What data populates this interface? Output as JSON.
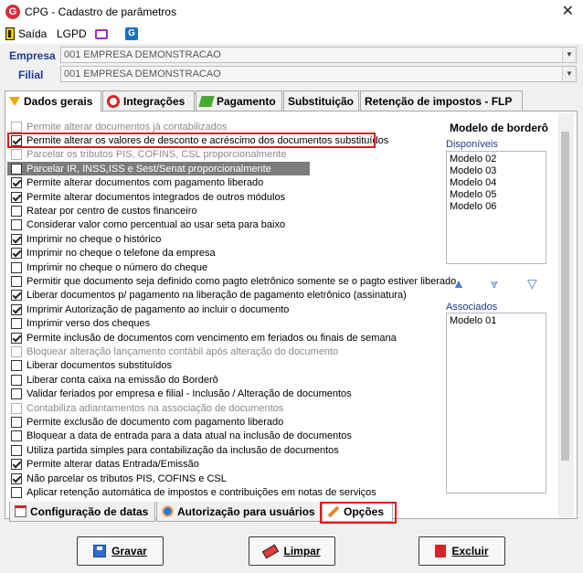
{
  "window": {
    "title": "CPG - Cadastro de parâmetros",
    "icon": "G",
    "close": "✕"
  },
  "toolbar": {
    "exit_label": "Saída",
    "lgpd_label": "LGPD"
  },
  "fields": {
    "empresa_label": "Empresa",
    "empresa_value": "001 EMPRESA DEMONSTRACAO",
    "filial_label": "Filial",
    "filial_value": "001 EMPRESA DEMONSTRACAO"
  },
  "tabs": [
    {
      "label": "Dados gerais",
      "icon": "filter-icon",
      "active": true
    },
    {
      "label": "Integrações",
      "icon": "integration-icon",
      "active": false
    },
    {
      "label": "Pagamento",
      "icon": "payment-icon",
      "active": false
    },
    {
      "label": "Substituição",
      "active": false
    },
    {
      "label": "Retenção de impostos - FLP",
      "active": false
    }
  ],
  "options": [
    {
      "label": "Permite alterar documentos já contabilizados",
      "checked": false,
      "disabled": true
    },
    {
      "label": "Permite alterar os valores de desconto e acréscimo dos documentos substituídos",
      "checked": true,
      "disabled": false
    },
    {
      "label": "Parcelar os tributos PIS, COFINS, CSL proporcionalmente",
      "checked": false,
      "disabled": true
    },
    {
      "label": "Parcelar IR, INSS,ISS e Sest/Senat proporcionalmente",
      "checked": false,
      "disabled": false,
      "selected": true
    },
    {
      "label": "Permite alterar documentos com pagamento liberado",
      "checked": true,
      "disabled": false
    },
    {
      "label": "Permite alterar documentos integrados de outros módulos",
      "checked": true,
      "disabled": false
    },
    {
      "label": "Ratear por centro de custos financeiro",
      "checked": false,
      "disabled": false
    },
    {
      "label": "Considerar valor como percentual ao usar seta para baixo",
      "checked": false,
      "disabled": false
    },
    {
      "label": "Imprimir no cheque o histórico",
      "checked": true,
      "disabled": false
    },
    {
      "label": "Imprimir no cheque o telefone da empresa",
      "checked": true,
      "disabled": false
    },
    {
      "label": "Imprimir no cheque o número do cheque",
      "checked": false,
      "disabled": false
    },
    {
      "label": "Permitir que documento seja definido como pagto eletrônico somente se o pagto estiver liberado",
      "checked": false,
      "disabled": false
    },
    {
      "label": "Liberar documentos p/ pagamento na liberação de pagamento eletrônico (assinatura)",
      "checked": true,
      "disabled": false
    },
    {
      "label": "Imprimir Autorização de pagamento ao incluir o documento",
      "checked": true,
      "disabled": false
    },
    {
      "label": "Imprimir verso dos cheques",
      "checked": false,
      "disabled": false
    },
    {
      "label": "Permite inclusão de documentos com vencimento em feriados ou finais de semana",
      "checked": true,
      "disabled": false
    },
    {
      "label": "Bloquear alteração lançamento contábil após alteração do documento",
      "checked": false,
      "disabled": true
    },
    {
      "label": "Liberar documentos substituídos",
      "checked": false,
      "disabled": false
    },
    {
      "label": "Liberar conta caixa na emissão do Borderô",
      "checked": false,
      "disabled": false
    },
    {
      "label": "Validar feriados por empresa e filial - Inclusão / Alteração de documentos",
      "checked": false,
      "disabled": false
    },
    {
      "label": "Contabiliza adiantamentos na associação de documentos",
      "checked": false,
      "disabled": true
    },
    {
      "label": "Permite exclusão de documento com pagamento liberado",
      "checked": false,
      "disabled": false
    },
    {
      "label": "Bloquear a data de entrada para a data atual na inclusão de documentos",
      "checked": false,
      "disabled": false
    },
    {
      "label": "Utiliza partida simples para contabilização da inclusão de documentos",
      "checked": false,
      "disabled": false
    },
    {
      "label": "Permite alterar datas Entrada/Emissão",
      "checked": true,
      "disabled": false
    },
    {
      "label": "Não parcelar os tributos PIS, COFINS e CSL",
      "checked": true,
      "disabled": false
    },
    {
      "label": "Aplicar retenção automática de impostos e contribuições em notas de serviços",
      "checked": false,
      "disabled": false
    }
  ],
  "bordero": {
    "title": "Modelo de borderô",
    "available_label": "Disponíveis",
    "available": [
      "Modelo 02",
      "Modelo 03",
      "Modelo 04",
      "Modelo 05",
      "Modelo 06"
    ],
    "associated_label": "Associados",
    "associated": [
      "Modelo 01"
    ],
    "up": "▲",
    "move": "⩔",
    "down": "▽"
  },
  "bottom_tabs": [
    {
      "label": "Configuração de datas",
      "icon": "calendar-icon"
    },
    {
      "label": "Autorização para usuários",
      "icon": "user-icon"
    },
    {
      "label": "Opções",
      "icon": "tools-icon",
      "active": true
    }
  ],
  "buttons": {
    "save": "Gravar",
    "clear": "Limpar",
    "delete": "Excluir"
  }
}
